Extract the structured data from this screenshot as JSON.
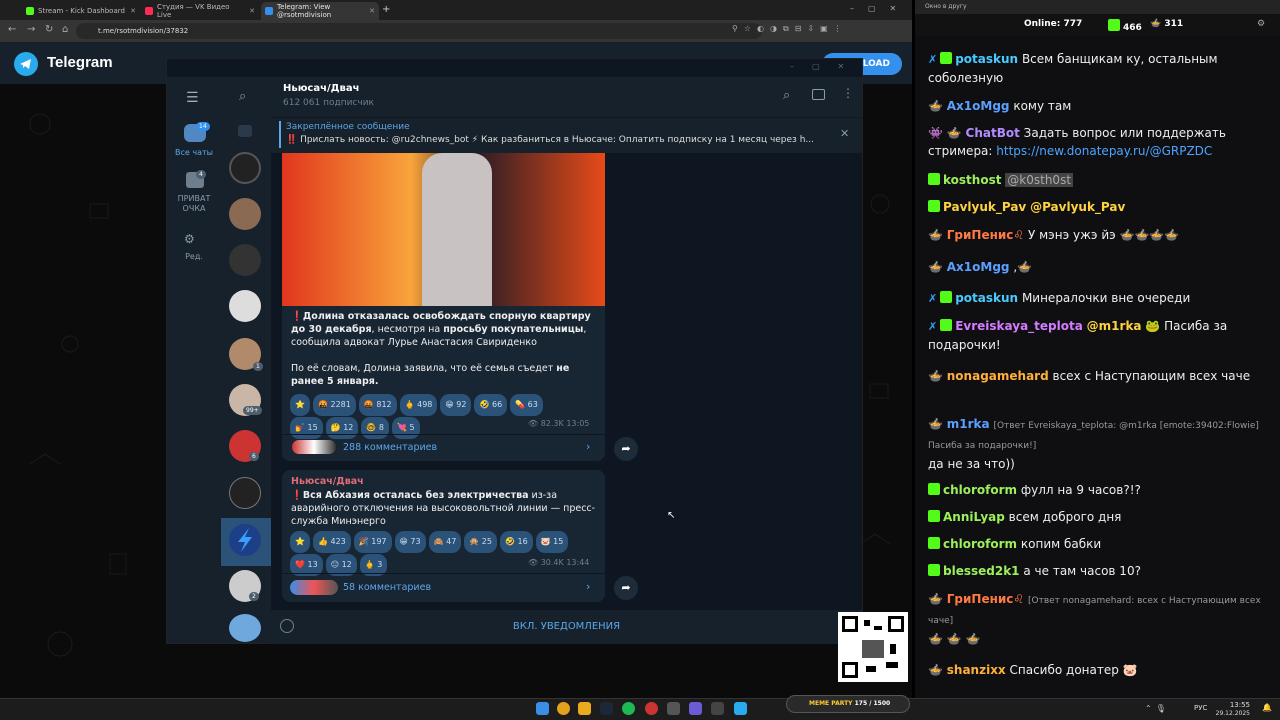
{
  "browser": {
    "tabs": [
      "Stream - Kick Dashboard",
      "Студия — VK Видео Live",
      "Telegram: View @rsotmdivision"
    ],
    "url": "t.me/rsotmdivision/37832"
  },
  "telegram_web": {
    "brand": "Telegram",
    "download_label": "LOAD"
  },
  "channel": {
    "title": "Ньюсач/Двач",
    "subscribers": "612 061 подписчик"
  },
  "left_rail": {
    "all_chats_label": "Все чаты",
    "all_chats_badge": "14",
    "private_label": "ПРИВАТ\nОЧКА",
    "private_badge": "4",
    "edit_label": "Ред."
  },
  "chat_badges": {
    "a": "1",
    "b": "99+",
    "c": "6",
    "d": "2"
  },
  "pinned": {
    "heading": "Закреплённое сообщение",
    "text": "‼️ Прислать новость: @ru2chnews_bot ⚡ Как разбаниться в Ньюсаче:    Оплатить подписку на 1 месяц через h..."
  },
  "post1": {
    "text_a": "Долина отказалась освобождать спорную квартиру до 30 декабря",
    "text_b": ", несмотря на ",
    "text_c": "просьбу покупательницы",
    "text_d": ", сообщила адвокат Лурье Анастасия Свириденко",
    "para2a": "По её словам, Долина заявила, что её семья съедет ",
    "para2b": "не ранее 5 января.",
    "reactions": [
      "⭐",
      "🤬 2281",
      "🤬 812",
      "🖕 498",
      "😁 92",
      "🤣 66",
      "💊 63",
      "💅 15",
      "🤔 12",
      "🤓 8",
      "💘 5"
    ],
    "views": "82.3K",
    "time": "13:05",
    "comments": "288 комментариев"
  },
  "post2": {
    "author": "Ньюсач/Двач",
    "text_a": "Вся Абхазия осталась без электричества",
    "text_b": " из-за аварийного отключения на высоковольтной линии — пресс-служба Минэнерго",
    "reactions": [
      "⭐",
      "👍 423",
      "🎉 197",
      "😁 73",
      "🙈 47",
      "🙊 25",
      "🤣 16",
      "🐷 15",
      "❤️ 13",
      "😐 12",
      "🖕 3"
    ],
    "views": "30.4K",
    "time": "13:44",
    "comments": "58 комментариев"
  },
  "bottom": {
    "notify": "ВКЛ. УВЕДОМЛЕНИЯ"
  },
  "right_panel": {
    "title": "Окно в другу",
    "online_label": "Online:",
    "online": "777",
    "kick_count": "466",
    "other_count": "311"
  },
  "chat": [
    {
      "user": "potaskun",
      "color": "#48c9ff",
      "text": "Всем банщикам ку, остальным соболезную",
      "kick": true,
      "sword": true
    },
    {
      "user": "Ax1oMgg",
      "color": "#5aa0ff",
      "text": "кому там"
    },
    {
      "user": "ChatBot",
      "color": "#b48cff",
      "text": "Задать вопрос или поддержать стримера: ",
      "link": "https://new.donatepay.ru/@GRPZDC"
    },
    {
      "user": "kosthost",
      "color": "#9cf05c",
      "mention": "@k0sth0st",
      "kick": true
    },
    {
      "user": "Pavlyuk_Pav",
      "color": "#ffd23f",
      "text": "@Pavlyuk_Pav",
      "kick": true
    },
    {
      "user": "ГриПенис♌",
      "color": "#ff7a45",
      "text": "У мэнэ ужэ йэ"
    },
    {
      "user": "Ax1oMgg",
      "color": "#5aa0ff",
      "text": ","
    },
    {
      "user": "potaskun",
      "color": "#48c9ff",
      "text": "Минералочки вне очереди",
      "kick": true,
      "sword": true
    },
    {
      "user": "Evreiskaya_teplota",
      "color": "#d47cff",
      "text": "@m1rka",
      "text2": " Пасиба за подарочки!",
      "kick": true,
      "sword": true
    },
    {
      "user": "nonagamehard",
      "color": "#ffb03a",
      "text": "всех с Наступающим всех чаче"
    },
    {
      "user": "m1rka",
      "color": "#5aa0ff",
      "reply": "[Ответ Evreiskaya_teplota: @m1rka [emote:39402:Flowie] Пасиба за подарочки!]",
      "text": "да не за что))"
    },
    {
      "user": "chloroform",
      "color": "#9cf05c",
      "text": "фулл на 9 часов?!?",
      "kick": true
    },
    {
      "user": "AnniLyap",
      "color": "#9cf05c",
      "text": "всем доброго дня",
      "kick": true
    },
    {
      "user": "chloroform",
      "color": "#9cf05c",
      "text": "копим бабки",
      "kick": true
    },
    {
      "user": "blessed2k1",
      "color": "#9cf05c",
      "text": "а че там часов 10?",
      "kick": true
    },
    {
      "user": "ГриПенис♌",
      "color": "#ff7a45",
      "reply": "[Ответ nonagamehard: всех с Наступающим всех чаче]"
    },
    {
      "user": "shanzixx",
      "color": "#ffb03a",
      "text": "Спасибо донатер"
    }
  ],
  "taskbar": {
    "lang": "РУС",
    "time": "13:55",
    "date": "29.12.2025"
  },
  "meme": {
    "label": "MEME PARTY",
    "count": "175 / 1500"
  }
}
